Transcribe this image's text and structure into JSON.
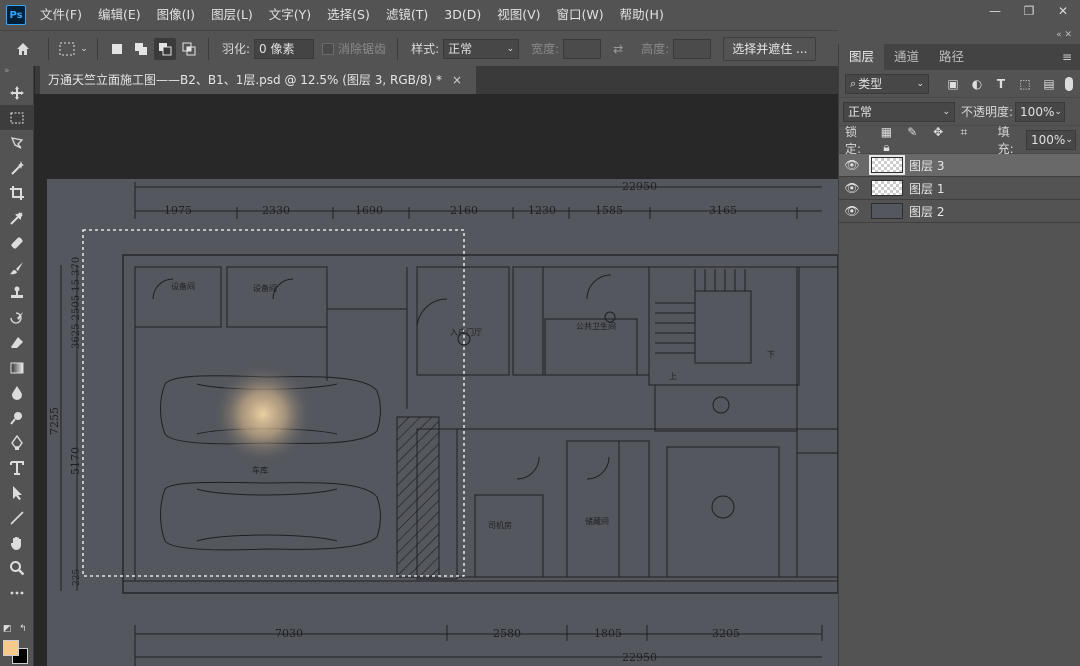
{
  "app": {
    "logo": "Ps"
  },
  "menubar": {
    "items": [
      "文件(F)",
      "编辑(E)",
      "图像(I)",
      "图层(L)",
      "文字(Y)",
      "选择(S)",
      "滤镜(T)",
      "3D(D)",
      "视图(V)",
      "窗口(W)",
      "帮助(H)"
    ],
    "window_controls": {
      "minimize": "—",
      "restore": "❐",
      "close": "✕"
    }
  },
  "options": {
    "feather_label": "羽化:",
    "feather_value": "0 像素",
    "antialias_label": "消除锯齿",
    "style_label": "样式:",
    "style_value": "正常",
    "width_label": "宽度:",
    "height_label": "高度:",
    "select_mask_button": "选择并遮住 ..."
  },
  "document": {
    "tab_title": "万通天竺立面施工图——B2、B1、1层.psd @ 12.5% (图层 3, RGB/8) *",
    "close": "×"
  },
  "colors": {
    "foreground": "#f7c98a",
    "background": "#000000",
    "accent": "#31a8ff"
  },
  "drawing": {
    "top_total": "22950",
    "top_dims": [
      "1975",
      "2330",
      "1690",
      "2160",
      "1230",
      "1585",
      "3165"
    ],
    "bottom_total": "22950",
    "bottom_dims": [
      "7030",
      "2580",
      "1805",
      "3205"
    ],
    "left_total": "7255",
    "left_dims": [
      "3625",
      "5170",
      "225"
    ],
    "left_small": "3625 2505 15 370",
    "rooms": [
      "设备间",
      "设备间",
      "车库",
      "入户门厅",
      "公共卫生间",
      "司机房",
      "储藏间",
      "上",
      "下"
    ]
  },
  "layers_panel": {
    "tabs": [
      "图层",
      "通道",
      "路径"
    ],
    "filter_kind": "类型",
    "blend_mode": "正常",
    "opacity_label": "不透明度:",
    "opacity_value": "100%",
    "lock_label": "锁定:",
    "fill_label": "填充:",
    "fill_value": "100%",
    "layers": [
      {
        "name": "图层 3",
        "selected": true
      },
      {
        "name": "图层 1",
        "selected": false
      },
      {
        "name": "图层 2",
        "selected": false
      }
    ]
  }
}
